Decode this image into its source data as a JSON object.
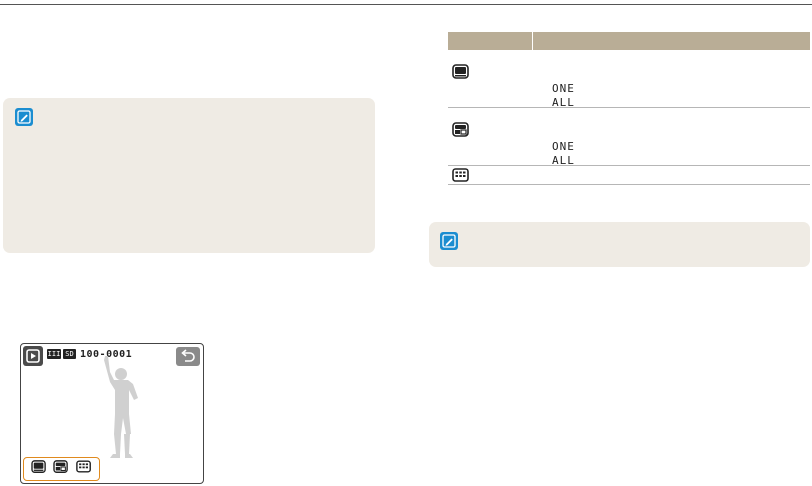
{
  "colors": {
    "table_header": "#b9ad96",
    "note_background": "#efebe4",
    "note_icon": "#1b8dd0",
    "highlight_border": "#e08a1e"
  },
  "left_note": {
    "icon": "note-pencil-icon"
  },
  "table": {
    "header": [
      "",
      ""
    ],
    "rows": [
      {
        "icon": "single-view-icon",
        "options": [
          "ONE",
          "ALL"
        ]
      },
      {
        "icon": "multi-view-icon",
        "options": [
          "ONE",
          "ALL"
        ]
      },
      {
        "icon": "grid-view-icon",
        "options": []
      }
    ]
  },
  "right_note": {
    "icon": "note-pencil-icon"
  },
  "camera_screen": {
    "mode_icon": "playback-mode-icon",
    "battery_icon": "battery-icon",
    "memory_card_icon": "memory-card-icon",
    "battery_text": "III",
    "memory_text": "SD",
    "file_number": "100-0001",
    "back_icon": "back-arrow-icon",
    "thumbnail_icons": [
      "single-view-icon",
      "multi-view-icon",
      "grid-view-icon"
    ]
  }
}
